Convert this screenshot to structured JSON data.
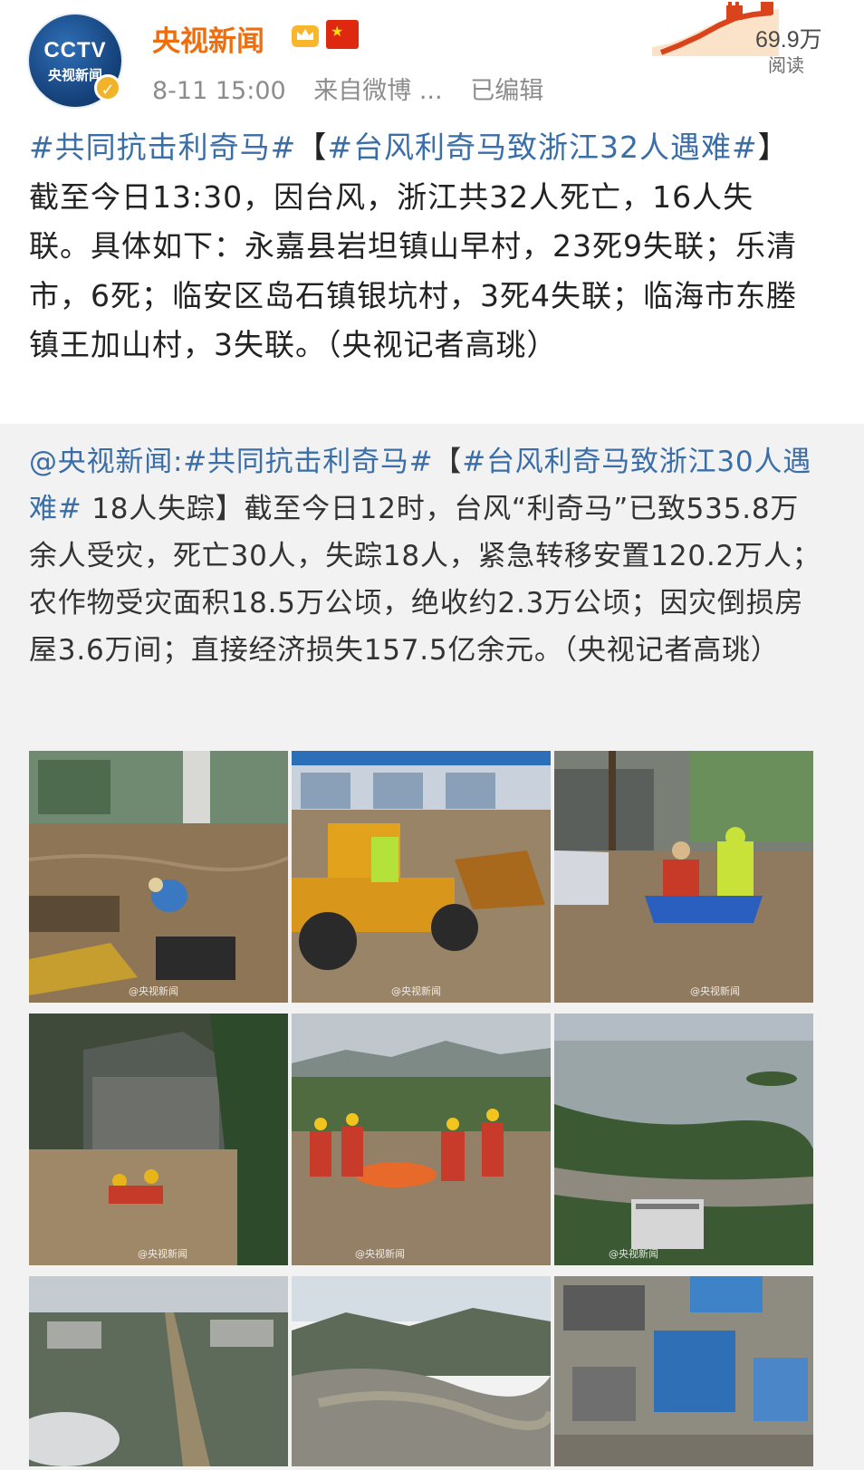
{
  "author": {
    "name": "央视新闻",
    "avatar_text": "CCTV",
    "avatar_sub": "央视新闻",
    "date": "8-11 15:00",
    "source": "来自微博 ...",
    "edited": "已编辑",
    "reads_count": "69.9万",
    "reads_label": "阅读"
  },
  "post": {
    "topic1": "#共同抗击利奇马#",
    "bracket_open": "【",
    "topic2": "#台风利奇马致浙江32人遇难#",
    "bracket_close": "】",
    "body": "截至今日13:30，因台风，浙江共32人死亡，16人失联。具体如下：永嘉县岩坦镇山早村，23死9失联；乐清市，6死；临安区岛石镇银坑村，3死4失联；临海市东塍镇王加山村，3失联。（央视记者高珧）"
  },
  "repost": {
    "mention": "@央视新闻:",
    "topic1": "#共同抗击利奇马#",
    "bracket_open": "【",
    "topic2": "#台风利奇马致浙江30人遇难#",
    "head_rest": " 18人失踪】",
    "body": "截至今日12时，台风“利奇马”已致535.8万余人受灾，死亡30人，失踪18人，紧急转移安置120.2万人；农作物受灾面积18.5万公顷，绝收约2.3万公顷；因灾倒损房屋3.6万间；直接经济损失157.5亿余元。（央视记者高珧）"
  },
  "photos": [
    {
      "name": "flooded-street-rescue-photo",
      "watermark": "@央视新闻"
    },
    {
      "name": "bulldozer-flood-rescue-photo",
      "watermark": "@央视新闻"
    },
    {
      "name": "boat-rescue-street-photo",
      "watermark": "@央视新闻"
    },
    {
      "name": "flooded-village-rescue-photo",
      "watermark": "@央视新闻"
    },
    {
      "name": "rescuers-raft-photo",
      "watermark": "@央视新闻"
    },
    {
      "name": "aerial-flood-lake-photo",
      "watermark": "@央视新闻"
    },
    {
      "name": "aerial-city-flood-photo",
      "watermark": ""
    },
    {
      "name": "aerial-valley-flood-photo",
      "watermark": ""
    },
    {
      "name": "aerial-rooftops-photo",
      "watermark": ""
    }
  ],
  "colors": {
    "username": "#f06d0e",
    "topic_link": "#3a6ea8",
    "repost_bg": "#f2f2f2"
  }
}
